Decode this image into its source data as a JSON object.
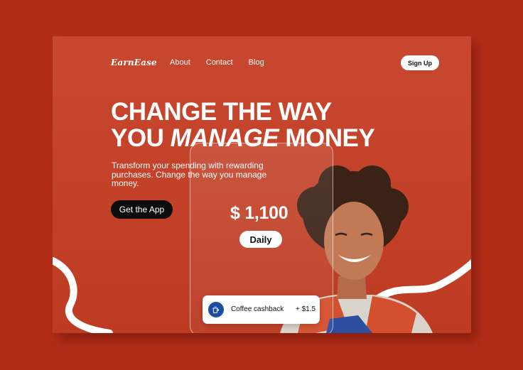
{
  "brand": {
    "logo_text": "EarnEase"
  },
  "nav": {
    "items": [
      "About",
      "Contact",
      "Blog"
    ],
    "signup_label": "Sign Up"
  },
  "hero": {
    "line1": "CHANGE THE WAY",
    "line2_prefix": "YOU ",
    "line2_emphasis": "MANAGE",
    "line2_suffix": " MONEY",
    "subtitle": "Transform your spending with rewarding purchases. Change the way you manage money.",
    "cta_label": "Get the App"
  },
  "phone_card": {
    "amount": "$ 1,100",
    "period": "Daily",
    "cashback_label": "Coffee cashback",
    "cashback_amount": "+ $1.5",
    "cashback_icon": "coffee-cup-icon"
  },
  "colors": {
    "page_bg": "#b32d16",
    "card_bg": "#c4432b",
    "button_dark": "#0d0d0d",
    "icon_blue": "#1b4ea3"
  }
}
